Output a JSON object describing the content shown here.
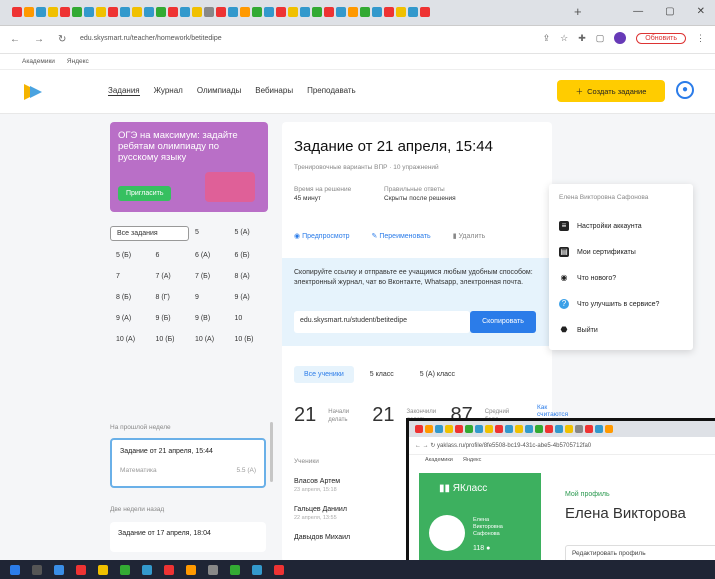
{
  "browser": {
    "url": "edu.skysmart.ru/teacher/homework/betitedipe",
    "update_label": "Обновить",
    "bookmarks": [
      "Академики",
      "Яндекс"
    ]
  },
  "header": {
    "nav": [
      "Задания",
      "Журнал",
      "Олимпиады",
      "Вебинары",
      "Преподавать"
    ],
    "create_label": "Создать задание"
  },
  "promo": {
    "text": "ОГЭ на максимум: задайте ребятам олимпиаду по русскому языку",
    "button": "Пригласить"
  },
  "filters": [
    "Все задания",
    "5",
    "5 (А)",
    "5 (Б)",
    "6",
    "6 (А)",
    "6 (Б)",
    "7",
    "7 (А)",
    "7 (Б)",
    "8 (А)",
    "8 (Б)",
    "8 (Г)",
    "9",
    "9 (А)",
    "9 (А)",
    "9 (Б)",
    "9 (В)",
    "10",
    "10 (А)",
    "10 (Б)",
    "10 (А)",
    "10 (Б)"
  ],
  "sections": {
    "last_week": "На прошлой неделе",
    "two_weeks": "Две недели назад"
  },
  "tasks": [
    {
      "title": "Задание от 21 апреля, 15:44",
      "subject": "Математика",
      "grade": "5.5 (А)"
    },
    {
      "title": "Задание от 17 апреля, 18:04"
    }
  ],
  "main": {
    "title": "Задание от 21 апреля, 15:44",
    "subtitle": "Тренировочные варианты ВПР · 10 упражнений",
    "time_label": "Время на решение",
    "time_value": "45 минут",
    "answers_label": "Правильные ответы",
    "answers_value": "Скрыты после решения",
    "preview": "Предпросмотр",
    "rename": "Переименовать",
    "delete": "Удалить",
    "share_text": "Скопируйте ссылку и отправьте ее учащимся любым удобным способом: электронный журнал, чат во Вконтакте, Whatsapp, электронная почта.",
    "share_link": "edu.skysmart.ru/student/betitedipe",
    "copy_label": "Скопировать",
    "class_tabs": [
      "Все ученики",
      "5 класс",
      "5 (А) класс"
    ],
    "stats": [
      {
        "num": "21",
        "label": "Начали делать"
      },
      {
        "num": "21",
        "label": "Закончили делать"
      },
      {
        "num": "87",
        "label": "Средний балл"
      }
    ],
    "how_link": "Как считаются",
    "students_header": "Ученики",
    "students": [
      {
        "name": "Власов Артем",
        "date": "23 апреля, 15:18"
      },
      {
        "name": "Гальцев Даниил",
        "date": "22 апреля, 13:55"
      },
      {
        "name": "Давыдов Михаил"
      }
    ]
  },
  "dropdown": {
    "name": "Елена Викторовна Сафонова",
    "items": [
      "Настройки аккаунта",
      "Мои сертификаты",
      "Что нового?",
      "Что улучшить в сервисе?",
      "Выйти"
    ]
  },
  "win2": {
    "url": "yaklass.ru/profile/8fe5508-bc19-431c-abe5-4b5705712fa0",
    "bookmarks": [
      "Академики",
      "Яндекс"
    ],
    "logo": "ЯКласс",
    "user": "Елена Викторовна Сафонова",
    "coins": "118",
    "profile_link": "Мой профиль",
    "profile_name": "Елена Викторова",
    "edit_label": "Редактировать профиль"
  }
}
